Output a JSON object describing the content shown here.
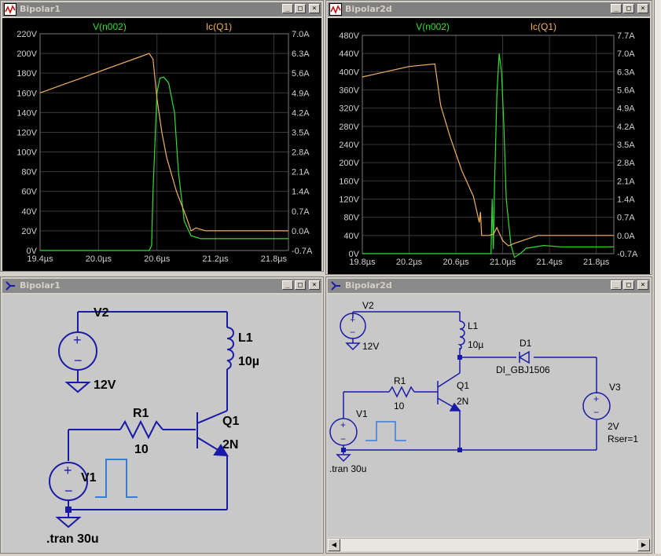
{
  "windows": {
    "plot1": {
      "title": "Bipolar1",
      "trace_v": "V(n002)",
      "trace_i": "Ic(Q1)",
      "y_left_ticks": [
        "220V",
        "200V",
        "180V",
        "160V",
        "140V",
        "120V",
        "100V",
        "80V",
        "60V",
        "40V",
        "20V",
        "0V"
      ],
      "y_right_ticks": [
        "7.0A",
        "6.3A",
        "5.6A",
        "4.9A",
        "4.2A",
        "3.5A",
        "2.8A",
        "2.1A",
        "1.4A",
        "0.7A",
        "0.0A",
        "-0.7A"
      ],
      "x_ticks": [
        "19.4µs",
        "20.0µs",
        "20.6µs",
        "21.2µs",
        "21.8µs"
      ]
    },
    "plot2": {
      "title": "Bipolar2d",
      "trace_v": "V(n002)",
      "trace_i": "Ic(Q1)",
      "y_left_ticks": [
        "480V",
        "440V",
        "400V",
        "360V",
        "320V",
        "280V",
        "240V",
        "200V",
        "160V",
        "120V",
        "80V",
        "40V",
        "0V"
      ],
      "y_right_ticks": [
        "7.7A",
        "7.0A",
        "6.3A",
        "5.6A",
        "4.9A",
        "4.2A",
        "3.5A",
        "2.8A",
        "2.1A",
        "1.4A",
        "0.7A",
        "0.0A",
        "-0.7A"
      ],
      "x_ticks": [
        "19.8µs",
        "20.2µs",
        "20.6µs",
        "21.0µs",
        "21.4µs",
        "21.8µs"
      ]
    },
    "schem1": {
      "title": "Bipolar1",
      "v2": "V2",
      "v2_val": "12V",
      "l1": "L1",
      "l1_val": "10µ",
      "r1": "R1",
      "r1_val": "10",
      "q1": "Q1",
      "q1_val": "2N",
      "v1": "V1",
      "tran": ".tran 30u"
    },
    "schem2": {
      "title": "Bipolar2d",
      "v2": "V2",
      "v2_val": "12V",
      "l1": "L1",
      "l1_val": "10µ",
      "d1": "D1",
      "d1_val": "DI_GBJ1506",
      "v3": "V3",
      "v3_val": "2V",
      "v3_rser": "Rser=1",
      "r1": "R1",
      "r1_val": "10",
      "q1": "Q1",
      "q1_val": "2N",
      "v1": "V1",
      "tran": ".tran 30u"
    }
  },
  "window_buttons": {
    "min": "_",
    "max": "□",
    "close": "×"
  },
  "colors": {
    "plot_bg": "#000000",
    "grid": "#3a3a3a",
    "voltage_trace": "#30e030",
    "current_trace": "#f0b060",
    "axis_text": "#d0d0d0",
    "wire": "#1a1aa8",
    "schem_bg": "#c8c8c8"
  },
  "chart_data": [
    {
      "type": "line",
      "title": "Bipolar1",
      "xlim": [
        19.4,
        21.95
      ],
      "ylim": [
        0,
        220
      ],
      "y2lim": [
        -0.7,
        7.0
      ],
      "series": [
        {
          "name": "V(n002)",
          "axis": "left",
          "x": [
            19.4,
            20.3,
            20.52,
            20.545,
            20.56,
            20.6,
            20.63,
            20.67,
            20.72,
            20.78,
            20.82,
            20.88,
            20.95,
            21.05,
            21.2,
            21.95
          ],
          "y": [
            0,
            0,
            0,
            5,
            60,
            160,
            175,
            176,
            170,
            140,
            80,
            30,
            15,
            12,
            12,
            12
          ]
        },
        {
          "name": "Ic(Q1)",
          "axis": "right",
          "x": [
            19.4,
            19.6,
            19.8,
            20.0,
            20.2,
            20.4,
            20.52,
            20.56,
            20.6,
            20.65,
            20.7,
            20.8,
            20.9,
            20.95,
            21.0,
            21.1,
            21.95
          ],
          "y": [
            4.9,
            5.15,
            5.4,
            5.65,
            5.9,
            6.15,
            6.3,
            6.1,
            4.7,
            3.5,
            2.6,
            1.4,
            0.5,
            0.0,
            0.1,
            0.0,
            0.0
          ]
        }
      ]
    },
    {
      "type": "line",
      "title": "Bipolar2d",
      "xlim": [
        19.8,
        21.95
      ],
      "ylim": [
        0,
        480
      ],
      "y2lim": [
        -0.7,
        7.7
      ],
      "series": [
        {
          "name": "V(n002)",
          "axis": "left",
          "x": [
            19.8,
            20.8,
            20.9,
            20.905,
            20.91,
            20.92,
            20.93,
            20.95,
            20.97,
            20.99,
            21.01,
            21.03,
            21.07,
            21.1,
            21.15,
            21.2,
            21.35,
            21.5,
            21.95
          ],
          "y": [
            0,
            0,
            0,
            60,
            120,
            10,
            150,
            350,
            440,
            400,
            280,
            120,
            20,
            -8,
            0,
            12,
            18,
            15,
            15
          ]
        },
        {
          "name": "Ic(Q1)",
          "axis": "right",
          "x": [
            19.8,
            20.0,
            20.2,
            20.42,
            20.47,
            20.55,
            20.65,
            20.75,
            20.8,
            20.81,
            20.82,
            20.88,
            20.92,
            20.95,
            21.0,
            21.05,
            21.1,
            21.3,
            21.95
          ],
          "y": [
            6.1,
            6.3,
            6.5,
            6.6,
            5.0,
            3.8,
            2.5,
            1.5,
            0.5,
            0.9,
            0.0,
            0.0,
            0.05,
            0.3,
            -0.2,
            -0.4,
            -0.3,
            0.0,
            0.0
          ]
        }
      ]
    }
  ]
}
